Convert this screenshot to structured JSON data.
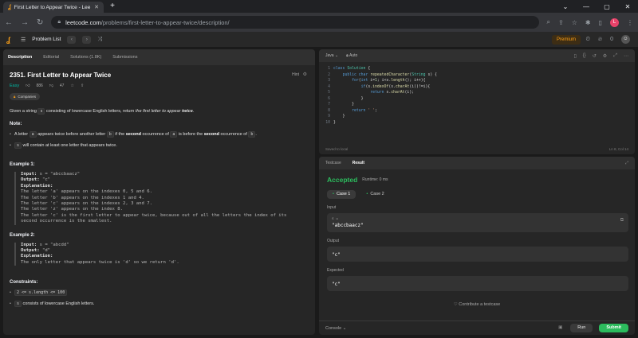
{
  "browser": {
    "tab_title": "First Letter to Appear Twice - Lee",
    "new_tab": "+",
    "domain": "leetcode.com",
    "path": "/problems/first-letter-to-appear-twice/description/",
    "avatar_letter": "L"
  },
  "header": {
    "problem_list": "Problem List",
    "premium": "Premium",
    "streak": "0"
  },
  "left_tabs": [
    "Description",
    "Editorial",
    "Solutions (1.8K)",
    "Submissions"
  ],
  "problem": {
    "title": "2351. First Letter to Appear Twice",
    "hint": "Hint",
    "difficulty": "Easy",
    "likes": "886",
    "dislikes": "47",
    "companies": "Companies",
    "desc_pre": "Given a string ",
    "desc_var": "s",
    "desc_mid": " consisting of lowercase English letters, return ",
    "desc_em": "the first letter to appear ",
    "desc_twice": "twice",
    "desc_end": ".",
    "note": "Note:",
    "bullet1_a": "A letter ",
    "bullet1_v1": "a",
    "bullet1_b": " appears twice before another letter ",
    "bullet1_v2": "b",
    "bullet1_c": " if the ",
    "bullet1_second": "second",
    "bullet1_d": " occurrence of ",
    "bullet1_v3": "a",
    "bullet1_e": " is before the ",
    "bullet1_second2": "second",
    "bullet1_f": " occurrence of ",
    "bullet1_v4": "b",
    "bullet1_g": ".",
    "bullet2_v": "s",
    "bullet2_text": " will contain at least one letter that appears twice.",
    "ex1_title": "Example 1:",
    "ex1_input_k": "Input:",
    "ex1_input_v": " s = \"abccbaacz\"",
    "ex1_output_k": "Output:",
    "ex1_output_v": " \"c\"",
    "ex1_expl_k": "Explanation:",
    "ex1_expl_v": "\nThe letter 'a' appears on the indexes 0, 5 and 6.\nThe letter 'b' appears on the indexes 1 and 4.\nThe letter 'c' appears on the indexes 2, 3 and 7.\nThe letter 'z' appears on the index 8.\nThe letter 'c' is the first letter to appear twice, because out of all the letters the index of its\nsecond occurrence is the smallest.",
    "ex2_title": "Example 2:",
    "ex2_input_k": "Input:",
    "ex2_input_v": " s = \"abcdd\"",
    "ex2_output_k": "Output:",
    "ex2_output_v": " \"d\"",
    "ex2_expl_k": "Explanation:",
    "ex2_expl_v": "\nThe only letter that appears twice is 'd' so we return 'd'.",
    "constraints_title": "Constraints:",
    "c1": "2 <= s.length <= 100",
    "c2_v": "s",
    "c2_text": " consists of lowercase English letters."
  },
  "editor": {
    "language": "Java",
    "mode": "Auto",
    "saved": "Saved to local",
    "cursor": "Ln 8, Col 14",
    "line_numbers": [
      "1",
      "2",
      "3",
      "4",
      "5",
      "6",
      "7",
      "8",
      "9",
      "10"
    ]
  },
  "result": {
    "tabs": [
      "Testcase",
      "Result"
    ],
    "status": "Accepted",
    "runtime": "Runtime: 0 ms",
    "case1": "Case 1",
    "case2": "Case 2",
    "input_label": "Input",
    "input_var": "s =",
    "input_val": "\"abccbaacz\"",
    "output_label": "Output",
    "output_val": "\"c\"",
    "expected_label": "Expected",
    "expected_val": "\"c\"",
    "contribute": "Contribute a testcase",
    "console": "Console",
    "run": "Run",
    "submit": "Submit"
  }
}
